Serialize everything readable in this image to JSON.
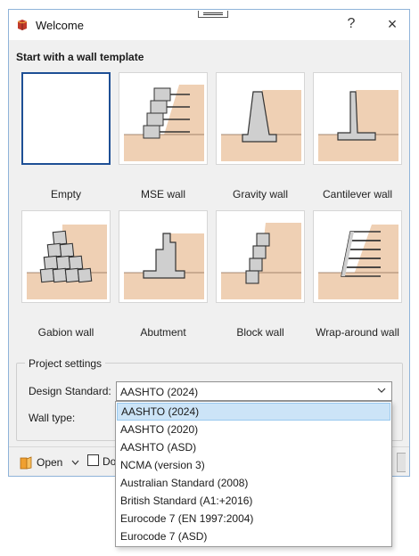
{
  "window": {
    "title": "Welcome",
    "help_label": "?",
    "close_label": "×"
  },
  "templates": {
    "heading": "Start with a wall template",
    "items": [
      {
        "label": "Empty",
        "icon": "empty-icon"
      },
      {
        "label": "MSE wall",
        "icon": "mse-wall-icon"
      },
      {
        "label": "Gravity wall",
        "icon": "gravity-wall-icon"
      },
      {
        "label": "Cantilever wall",
        "icon": "cantilever-wall-icon"
      },
      {
        "label": "Gabion wall",
        "icon": "gabion-wall-icon"
      },
      {
        "label": "Abutment",
        "icon": "abutment-icon"
      },
      {
        "label": "Block wall",
        "icon": "block-wall-icon"
      },
      {
        "label": "Wrap-around wall",
        "icon": "wrap-around-wall-icon"
      }
    ],
    "selected_index": 0
  },
  "project_settings": {
    "legend": "Project settings",
    "design_standard_label": "Design Standard:",
    "design_standard_value": "AASHTO (2024)",
    "wall_type_label": "Wall type:",
    "options": [
      "AASHTO (2024)",
      "AASHTO (2020)",
      "AASHTO (ASD)",
      "NCMA (version 3)",
      "Australian Standard (2008)",
      "British Standard (A1:+2016)",
      "Eurocode 7 (EN 1997:2004)",
      "Eurocode 7 (ASD)"
    ],
    "highlighted_option_index": 0
  },
  "footer": {
    "open_label": "Open",
    "checkbox_label_visible": "Do"
  },
  "colors": {
    "soil": "#efd0b4",
    "wall": "#cfcfcf",
    "outline": "#3a3a3a",
    "selected_border": "#1e4f95",
    "highlight": "#cce4f7"
  }
}
